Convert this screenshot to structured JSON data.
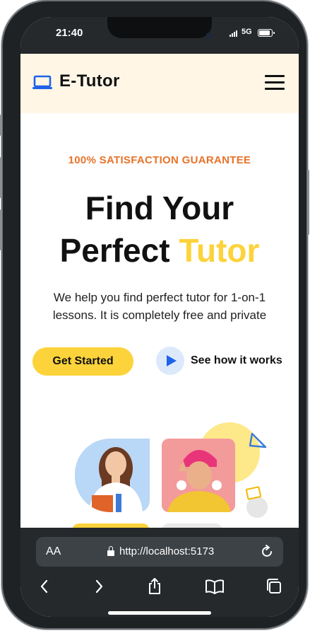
{
  "status_bar": {
    "time": "21:40",
    "network": "5G"
  },
  "navbar": {
    "brand": "E-Tutor",
    "logo_icon": "laptop-icon",
    "menu_icon": "hamburger-menu-icon"
  },
  "hero": {
    "eyebrow": "100% SATISFACTION GUARANTEE",
    "headline_line1": "Find Your",
    "headline_line2_plain": "Perfect",
    "headline_line2_accent": "Tutor",
    "description": "We help you find perfect tutor for 1-on-1 lessons. It is completely free and private",
    "cta_label": "Get Started",
    "play_icon": "play-icon",
    "how_label": "See how it works"
  },
  "browser": {
    "text_size_label": "AA",
    "url": "http://localhost:5173",
    "toolbar_icons": [
      "back-icon",
      "forward-icon",
      "share-icon",
      "bookmarks-icon",
      "tabs-icon"
    ]
  },
  "colors": {
    "accent_yellow": "#fcd33a",
    "eyebrow_orange": "#e8732a",
    "brand_blue": "#1e63e9",
    "navbar_bg": "#fff6e6",
    "chrome_dark": "#25292c"
  }
}
